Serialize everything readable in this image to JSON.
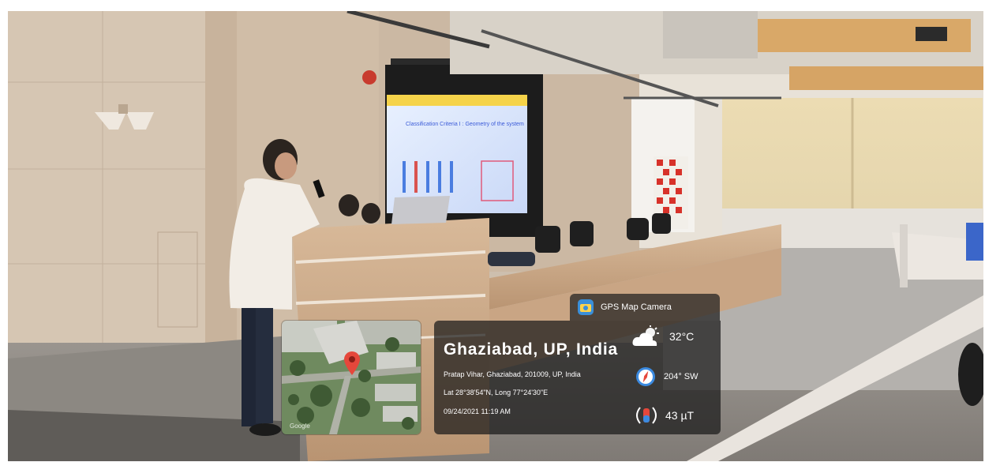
{
  "overlay": {
    "app_name": "GPS Map Camera",
    "location_title": "Ghaziabad, UP, India",
    "address": "Pratap Vihar, Ghaziabad, 201009, UP, India",
    "coordinates": "Lat 28°38'54\"N, Long 77°24'30\"E",
    "datetime": "09/24/2021 11:19 AM",
    "temperature": "32°C",
    "heading": "204° SW",
    "magnetic_field": "43 µT",
    "map_attribution": "Google",
    "icons": {
      "app": "camera-icon",
      "weather": "cloud-sun-icon",
      "compass": "compass-icon",
      "magnetic": "magnetic-field-icon",
      "pin": "map-pin-icon"
    }
  },
  "slide": {
    "title": "Classification Criteria I : Geometry of the system"
  },
  "colors": {
    "panel": "#191919",
    "pin": "#e5473b",
    "slide_accent": "#3b5bd8"
  }
}
